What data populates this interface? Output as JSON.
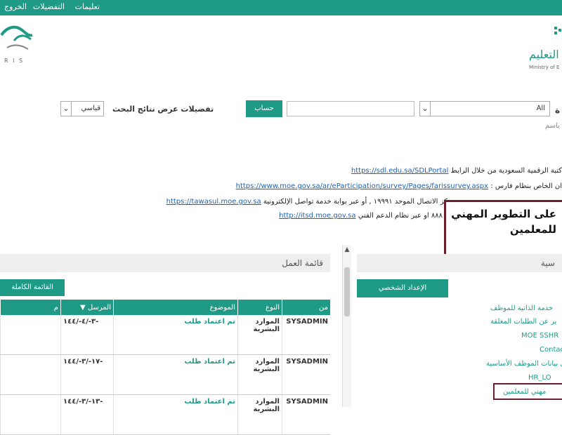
{
  "topbar": {
    "items": [
      "تعليمات",
      "التفضيلات",
      "الخروج"
    ]
  },
  "logos": {
    "right_ar": "التعليم",
    "right_en": "Ministry of E",
    "left_en": "R I S"
  },
  "search": {
    "scope_value": "All",
    "keyword_value": "",
    "search_button": "حساب",
    "prefs_label": "تفضيلات عرض نتائج البحث",
    "prefs_value": "قياسي",
    "right_label": "ة",
    "hint": "ياسم"
  },
  "links": [
    {
      "text": "كتبة الرقمية السعودية من خلال الرابط",
      "url": "https://sdl.edu.sa/SDLPortal"
    },
    {
      "text": "ان الخاص بنظام فارس :",
      "url": "https://www.moe.gov.sa/ar/eParticipation/survey/Pages/farissurvey.aspx"
    },
    {
      "text": "ى بمركز الاتصال الموحد ١٩٩٩١ , أو عبر بوابة خدمة تواصل الإلكترونية",
      "url": "https://tawasul.moe.gov.sa"
    },
    {
      "text": "٨٨٨ او عبر نظام الدعم الفني",
      "url": "http://itsd.moe.gov.sa"
    }
  ],
  "callout": {
    "line1": "على التطوير المهني",
    "line2": "للمعلمين"
  },
  "worklist": {
    "title": "قائمة العمل",
    "tab": "القائمة الكاملة",
    "side_title": "سية"
  },
  "table": {
    "headers": {
      "from": "من",
      "type": "النوع",
      "subject": "الموضوع",
      "sent": "المرسل",
      "extra": "م"
    },
    "rows": [
      {
        "from": "SYSADMIN",
        "type": "الموارد البشرية",
        "subject": "تم اعتماد طلب",
        "date": "٣-/٤-/١٤٤-"
      },
      {
        "from": "SYSADMIN",
        "type": "الموارد البشرية",
        "subject": "تم اعتماد طلب",
        "date": "١٧-/٣-/١٤٤-"
      },
      {
        "from": "SYSADMIN",
        "type": "الموارد البشرية",
        "subject": "تم اعتماد طلب",
        "date": "١٣-/٣-/١٤٤-"
      }
    ]
  },
  "sidebar": {
    "button": "الإعداد الشخصي",
    "items": [
      "خدمة الذاتية للموظف",
      "ير عن الطلبات المغلقة",
      "MOE SSHR",
      "Contac",
      "ل بيانات الموظف الأساسية",
      "HR_LO",
      "مهني للمعلمين"
    ]
  }
}
